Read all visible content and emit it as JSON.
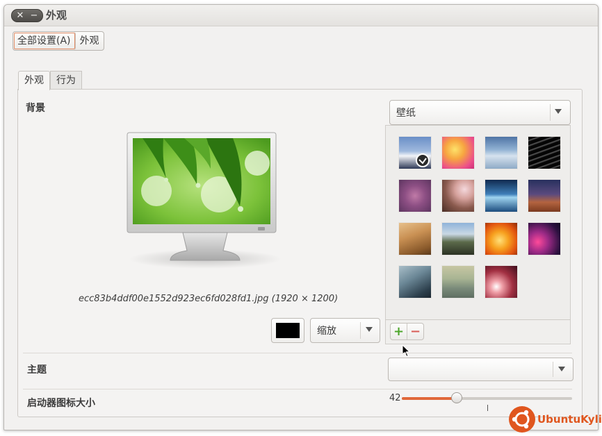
{
  "window": {
    "title": "外观",
    "close_glyph": "✕",
    "minimize_glyph": "−"
  },
  "breadcrumb": [
    "全部设置(A)",
    "外观"
  ],
  "tabs": [
    {
      "label": "外观",
      "active": true
    },
    {
      "label": "行为",
      "active": false
    }
  ],
  "background": {
    "label": "背景",
    "source_select": "壁纸",
    "filename": "ecc83b4ddf00e1552d923ec6fd028fd1.jpg (1920 × 1200)",
    "color_swatch": "#000000",
    "scale_select": "缩放",
    "selected_index": 0,
    "wallpaper_count": 15,
    "add_glyph": "+",
    "remove_glyph": "−"
  },
  "theme": {
    "label": "主题",
    "value": ""
  },
  "launcher": {
    "label": "启动器图标大小",
    "value": "42",
    "level_fraction": 0.32
  },
  "logo": {
    "text": "UbuntuKylin",
    "color": "#e0561e"
  },
  "accent_color": "#e0683a"
}
